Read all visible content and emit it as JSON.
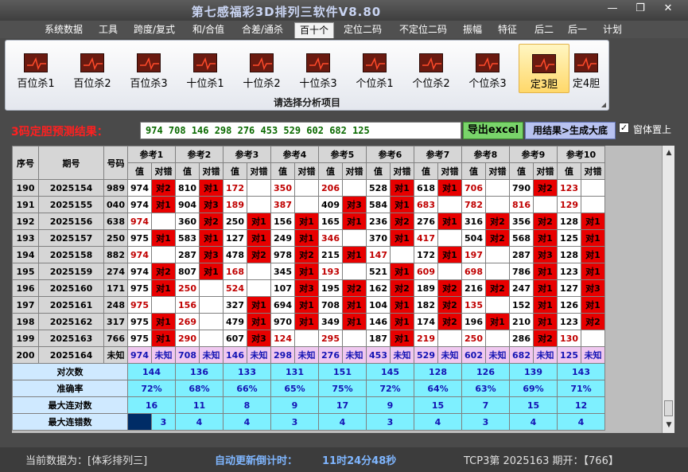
{
  "window": {
    "title": "第七感福彩3D排列三软件V8.80"
  },
  "menu": [
    "系统数据",
    "工具",
    "跨度/复式",
    "和/合值",
    "合差/通杀",
    "百十个",
    "定位二码",
    "不定位二码",
    "振幅",
    "特征",
    "后二",
    "后一",
    "计划"
  ],
  "menu_active": 5,
  "ribbon": {
    "buttons": [
      "百位杀1",
      "百位杀2",
      "百位杀3",
      "十位杀1",
      "十位杀2",
      "十位杀3",
      "个位杀1",
      "个位杀2",
      "个位杀3",
      "定3胆",
      "定4胆"
    ],
    "selected": 9,
    "caption": "请选择分析项目"
  },
  "prediction": {
    "label": "3码定胆预测结果：",
    "value": "974 708 146 298 276 453 529 602 682 125",
    "export_label": "导出excel",
    "generate_label": "用结果>生成大底",
    "checkbox_checked": true,
    "checkbox_mark": "✓",
    "checkbox_label": "窗体置上"
  },
  "grid": {
    "head_seq": "序号",
    "head_period": "期号",
    "head_code": "号码",
    "ref_groups": [
      "参考1",
      "参考2",
      "参考3",
      "参考4",
      "参考5",
      "参考6",
      "参考7",
      "参考8",
      "参考9",
      "参考10"
    ],
    "sub_value": "值",
    "sub_result": "对错",
    "rows": [
      {
        "seq": "190",
        "period": "2025154",
        "code": "989",
        "cells": [
          [
            "974",
            "对2"
          ],
          [
            "810",
            "对1"
          ],
          [
            "172",
            ""
          ],
          [
            "350",
            ""
          ],
          [
            "206",
            ""
          ],
          [
            "528",
            "对1"
          ],
          [
            "618",
            "对1"
          ],
          [
            "706",
            ""
          ],
          [
            "790",
            "对2"
          ],
          [
            "123",
            ""
          ]
        ],
        "red": [
          2,
          3,
          4,
          7,
          9
        ]
      },
      {
        "seq": "191",
        "period": "2025155",
        "code": "040",
        "cells": [
          [
            "974",
            "对1"
          ],
          [
            "904",
            "对3"
          ],
          [
            "189",
            ""
          ],
          [
            "387",
            ""
          ],
          [
            "409",
            "对3"
          ],
          [
            "584",
            "对1"
          ],
          [
            "683",
            ""
          ],
          [
            "782",
            ""
          ],
          [
            "816",
            ""
          ],
          [
            "129",
            ""
          ]
        ],
        "red": [
          2,
          3,
          6,
          7,
          8,
          9
        ]
      },
      {
        "seq": "192",
        "period": "2025156",
        "code": "638",
        "cells": [
          [
            "974",
            ""
          ],
          [
            "360",
            "对2"
          ],
          [
            "250",
            "对1"
          ],
          [
            "156",
            "对1"
          ],
          [
            "165",
            "对1"
          ],
          [
            "236",
            "对2"
          ],
          [
            "276",
            "对1"
          ],
          [
            "316",
            "对2"
          ],
          [
            "356",
            "对2"
          ],
          [
            "128",
            "对1"
          ]
        ],
        "red": [
          0
        ]
      },
      {
        "seq": "193",
        "period": "2025157",
        "code": "250",
        "cells": [
          [
            "975",
            "对1"
          ],
          [
            "583",
            "对1"
          ],
          [
            "127",
            "对1"
          ],
          [
            "249",
            "对1"
          ],
          [
            "346",
            ""
          ],
          [
            "370",
            "对1"
          ],
          [
            "417",
            ""
          ],
          [
            "504",
            "对2"
          ],
          [
            "568",
            "对1"
          ],
          [
            "125",
            "对1"
          ]
        ],
        "red": [
          4,
          6
        ]
      },
      {
        "seq": "194",
        "period": "2025158",
        "code": "882",
        "cells": [
          [
            "974",
            ""
          ],
          [
            "287",
            "对3"
          ],
          [
            "478",
            "对2"
          ],
          [
            "978",
            "对2"
          ],
          [
            "215",
            "对1"
          ],
          [
            "147",
            ""
          ],
          [
            "172",
            "对1"
          ],
          [
            "197",
            ""
          ],
          [
            "287",
            "对3"
          ],
          [
            "128",
            "对1"
          ]
        ],
        "red": [
          0,
          5,
          7
        ]
      },
      {
        "seq": "195",
        "period": "2025159",
        "code": "274",
        "cells": [
          [
            "974",
            "对2"
          ],
          [
            "807",
            "对1"
          ],
          [
            "168",
            ""
          ],
          [
            "345",
            "对1"
          ],
          [
            "193",
            ""
          ],
          [
            "521",
            "对1"
          ],
          [
            "609",
            ""
          ],
          [
            "698",
            ""
          ],
          [
            "786",
            "对1"
          ],
          [
            "123",
            "对1"
          ]
        ],
        "red": [
          2,
          4,
          6,
          7
        ]
      },
      {
        "seq": "196",
        "period": "2025160",
        "code": "171",
        "cells": [
          [
            "975",
            "对1"
          ],
          [
            "250",
            ""
          ],
          [
            "524",
            ""
          ],
          [
            "107",
            "对3"
          ],
          [
            "195",
            "对2"
          ],
          [
            "162",
            "对2"
          ],
          [
            "189",
            "对2"
          ],
          [
            "216",
            "对2"
          ],
          [
            "247",
            "对1"
          ],
          [
            "127",
            "对3"
          ]
        ],
        "red": [
          1,
          2
        ]
      },
      {
        "seq": "197",
        "period": "2025161",
        "code": "248",
        "cells": [
          [
            "975",
            ""
          ],
          [
            "156",
            ""
          ],
          [
            "327",
            "对1"
          ],
          [
            "694",
            "对1"
          ],
          [
            "708",
            "对1"
          ],
          [
            "104",
            "对1"
          ],
          [
            "182",
            "对2"
          ],
          [
            "135",
            ""
          ],
          [
            "152",
            "对1"
          ],
          [
            "126",
            "对1"
          ]
        ],
        "red": [
          0,
          1,
          7
        ]
      },
      {
        "seq": "198",
        "period": "2025162",
        "code": "317",
        "cells": [
          [
            "975",
            "对1"
          ],
          [
            "269",
            ""
          ],
          [
            "479",
            "对1"
          ],
          [
            "970",
            "对1"
          ],
          [
            "349",
            "对1"
          ],
          [
            "146",
            "对1"
          ],
          [
            "174",
            "对2"
          ],
          [
            "196",
            "对1"
          ],
          [
            "210",
            "对1"
          ],
          [
            "123",
            "对2"
          ]
        ],
        "red": [
          1
        ]
      },
      {
        "seq": "199",
        "period": "2025163",
        "code": "766",
        "cells": [
          [
            "975",
            "对1"
          ],
          [
            "290",
            ""
          ],
          [
            "607",
            "对3"
          ],
          [
            "124",
            ""
          ],
          [
            "295",
            ""
          ],
          [
            "187",
            "对1"
          ],
          [
            "219",
            ""
          ],
          [
            "250",
            ""
          ],
          [
            "286",
            "对2"
          ],
          [
            "130",
            ""
          ]
        ],
        "red": [
          1,
          3,
          4,
          6,
          7,
          9
        ]
      }
    ],
    "pred_row": {
      "seq": "200",
      "period": "2025164",
      "code": "未知",
      "values": [
        "974",
        "708",
        "146",
        "298",
        "276",
        "453",
        "529",
        "602",
        "682",
        "125"
      ],
      "status": "未知"
    },
    "summary": [
      {
        "label": "对次数",
        "values": [
          "144",
          "136",
          "133",
          "131",
          "151",
          "145",
          "128",
          "126",
          "139",
          "143"
        ]
      },
      {
        "label": "准确率",
        "values": [
          "72%",
          "68%",
          "66%",
          "65%",
          "75%",
          "72%",
          "64%",
          "63%",
          "69%",
          "71%"
        ]
      },
      {
        "label": "最大连对数",
        "values": [
          "16",
          "11",
          "8",
          "9",
          "17",
          "9",
          "15",
          "7",
          "15",
          "12"
        ]
      },
      {
        "label": "最大连错数",
        "values": [
          "3",
          "4",
          "4",
          "3",
          "4",
          "3",
          "4",
          "3",
          "4",
          "4"
        ]
      }
    ]
  },
  "status": {
    "current_data": "当前数据为：[体彩排列三]",
    "countdown_label": "自动更新倒计时：",
    "countdown_value": "11时24分48秒",
    "issue": "TCP3第 2025163 期开：【766】"
  }
}
